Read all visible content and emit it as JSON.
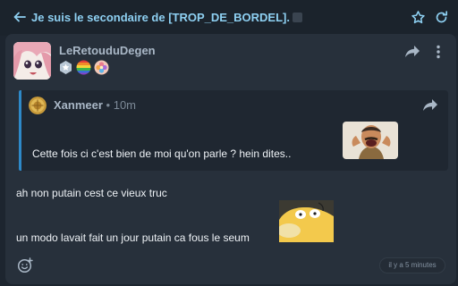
{
  "header": {
    "title": "Je suis le secondaire de [TROP_DE_BORDEL].",
    "back_icon": "arrow-left-icon",
    "star_icon": "star-icon",
    "refresh_icon": "refresh-icon"
  },
  "post": {
    "author": "LeRetouduDegen",
    "badges": [
      "star-badge",
      "rainbow-badge",
      "flower-badge"
    ],
    "quote": {
      "author": "Xanmeer",
      "time": "10m",
      "text": "Cette fois ci c'est bien de moi qu'on parle ? hein dites.."
    },
    "message_lines": [
      "ah non putain cest ce vieux truc",
      "un modo lavait fait un jour putain ca fous le seum"
    ],
    "timestamp": "il y a 5 minutes"
  },
  "colors": {
    "accent": "#8ed0f2",
    "quote_bar": "#2e89c8",
    "card_bg": "#27303b",
    "page_bg": "#1d252f"
  }
}
